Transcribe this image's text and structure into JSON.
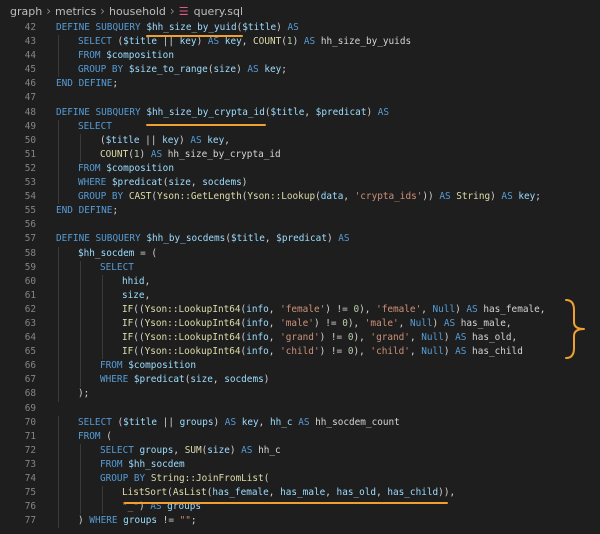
{
  "breadcrumb": {
    "items": [
      "graph",
      "metrics",
      "household"
    ],
    "file": "query.sql",
    "separator": "›",
    "file_icon": "database-icon"
  },
  "code": {
    "lines": [
      {
        "n": "42",
        "indent": 0,
        "t": [
          [
            "k",
            "DEFINE SUBQUERY "
          ],
          [
            "v",
            "$hh_size_by_yuid"
          ],
          [
            "p",
            "("
          ],
          [
            "v",
            "$title"
          ],
          [
            "p",
            ") "
          ],
          [
            "k",
            "AS"
          ]
        ]
      },
      {
        "n": "43",
        "indent": 1,
        "t": [
          [
            "k",
            "SELECT "
          ],
          [
            "p",
            "("
          ],
          [
            "v",
            "$title"
          ],
          [
            "p",
            " || "
          ],
          [
            "v",
            "key"
          ],
          [
            "p",
            ") "
          ],
          [
            "k",
            "AS "
          ],
          [
            "v",
            "key"
          ],
          [
            "p",
            ", "
          ],
          [
            "f",
            "COUNT"
          ],
          [
            "p",
            "("
          ],
          [
            "n",
            "1"
          ],
          [
            "p",
            ") "
          ],
          [
            "k",
            "AS "
          ],
          [
            "p",
            "hh_size_by_yuids"
          ]
        ]
      },
      {
        "n": "44",
        "indent": 1,
        "t": [
          [
            "k",
            "FROM "
          ],
          [
            "v",
            "$composition"
          ]
        ]
      },
      {
        "n": "45",
        "indent": 1,
        "t": [
          [
            "k",
            "GROUP BY "
          ],
          [
            "v",
            "$size_to_range"
          ],
          [
            "p",
            "("
          ],
          [
            "v",
            "size"
          ],
          [
            "p",
            ") "
          ],
          [
            "k",
            "AS "
          ],
          [
            "v",
            "key"
          ],
          [
            "p",
            ";"
          ]
        ]
      },
      {
        "n": "46",
        "indent": 0,
        "t": [
          [
            "k",
            "END DEFINE"
          ],
          [
            "p",
            ";"
          ]
        ]
      },
      {
        "n": "47",
        "indent": 0,
        "t": []
      },
      {
        "n": "48",
        "indent": 0,
        "t": [
          [
            "k",
            "DEFINE SUBQUERY "
          ],
          [
            "v",
            "$hh_size_by_crypta_id"
          ],
          [
            "p",
            "("
          ],
          [
            "v",
            "$title"
          ],
          [
            "p",
            ", "
          ],
          [
            "v",
            "$predicat"
          ],
          [
            "p",
            ") "
          ],
          [
            "k",
            "AS"
          ]
        ]
      },
      {
        "n": "49",
        "indent": 1,
        "t": [
          [
            "k",
            "SELECT"
          ]
        ]
      },
      {
        "n": "50",
        "indent": 2,
        "t": [
          [
            "p",
            "("
          ],
          [
            "v",
            "$title"
          ],
          [
            "p",
            " || "
          ],
          [
            "v",
            "key"
          ],
          [
            "p",
            ") "
          ],
          [
            "k",
            "AS "
          ],
          [
            "v",
            "key"
          ],
          [
            "p",
            ","
          ]
        ]
      },
      {
        "n": "51",
        "indent": 2,
        "t": [
          [
            "f",
            "COUNT"
          ],
          [
            "p",
            "("
          ],
          [
            "n",
            "1"
          ],
          [
            "p",
            ") "
          ],
          [
            "k",
            "AS "
          ],
          [
            "p",
            "hh_size_by_crypta_id"
          ]
        ]
      },
      {
        "n": "52",
        "indent": 1,
        "t": [
          [
            "k",
            "FROM "
          ],
          [
            "v",
            "$composition"
          ]
        ]
      },
      {
        "n": "53",
        "indent": 1,
        "t": [
          [
            "k",
            "WHERE "
          ],
          [
            "v",
            "$predicat"
          ],
          [
            "p",
            "("
          ],
          [
            "v",
            "size"
          ],
          [
            "p",
            ", "
          ],
          [
            "v",
            "socdems"
          ],
          [
            "p",
            ")"
          ]
        ]
      },
      {
        "n": "54",
        "indent": 1,
        "t": [
          [
            "k",
            "GROUP BY "
          ],
          [
            "f",
            "CAST"
          ],
          [
            "p",
            "("
          ],
          [
            "f",
            "Yson::GetLength"
          ],
          [
            "p",
            "("
          ],
          [
            "f",
            "Yson::Lookup"
          ],
          [
            "p",
            "("
          ],
          [
            "v",
            "data"
          ],
          [
            "p",
            ", "
          ],
          [
            "s",
            "'crypta_ids'"
          ],
          [
            "p",
            ")) "
          ],
          [
            "k",
            "AS "
          ],
          [
            "f",
            "String"
          ],
          [
            "p",
            ") "
          ],
          [
            "k",
            "AS "
          ],
          [
            "v",
            "key"
          ],
          [
            "p",
            ";"
          ]
        ]
      },
      {
        "n": "55",
        "indent": 0,
        "t": [
          [
            "k",
            "END DEFINE"
          ],
          [
            "p",
            ";"
          ]
        ]
      },
      {
        "n": "56",
        "indent": 0,
        "t": []
      },
      {
        "n": "57",
        "indent": 0,
        "t": [
          [
            "k",
            "DEFINE SUBQUERY "
          ],
          [
            "v",
            "$hh_by_socdems"
          ],
          [
            "p",
            "("
          ],
          [
            "v",
            "$title"
          ],
          [
            "p",
            ", "
          ],
          [
            "v",
            "$predicat"
          ],
          [
            "p",
            ") "
          ],
          [
            "k",
            "AS"
          ]
        ]
      },
      {
        "n": "58",
        "indent": 1,
        "t": [
          [
            "v",
            "$hh_socdem"
          ],
          [
            "p",
            " = ("
          ]
        ]
      },
      {
        "n": "59",
        "indent": 2,
        "t": [
          [
            "k",
            "SELECT"
          ]
        ]
      },
      {
        "n": "60",
        "indent": 3,
        "t": [
          [
            "v",
            "hhid"
          ],
          [
            "p",
            ","
          ]
        ]
      },
      {
        "n": "61",
        "indent": 3,
        "t": [
          [
            "v",
            "size"
          ],
          [
            "p",
            ","
          ]
        ]
      },
      {
        "n": "62",
        "indent": 3,
        "t": [
          [
            "f",
            "IF"
          ],
          [
            "p",
            "(("
          ],
          [
            "f",
            "Yson::LookupInt64"
          ],
          [
            "p",
            "("
          ],
          [
            "v",
            "info"
          ],
          [
            "p",
            ", "
          ],
          [
            "s",
            "'female'"
          ],
          [
            "p",
            ") != "
          ],
          [
            "n",
            "0"
          ],
          [
            "p",
            "), "
          ],
          [
            "s",
            "'female'"
          ],
          [
            "p",
            ", "
          ],
          [
            "k",
            "Null"
          ],
          [
            "p",
            ") "
          ],
          [
            "k",
            "AS "
          ],
          [
            "p",
            "has_female,"
          ]
        ]
      },
      {
        "n": "63",
        "indent": 3,
        "t": [
          [
            "f",
            "IF"
          ],
          [
            "p",
            "(("
          ],
          [
            "f",
            "Yson::LookupInt64"
          ],
          [
            "p",
            "("
          ],
          [
            "v",
            "info"
          ],
          [
            "p",
            ", "
          ],
          [
            "s",
            "'male'"
          ],
          [
            "p",
            ") != "
          ],
          [
            "n",
            "0"
          ],
          [
            "p",
            "), "
          ],
          [
            "s",
            "'male'"
          ],
          [
            "p",
            ", "
          ],
          [
            "k",
            "Null"
          ],
          [
            "p",
            ") "
          ],
          [
            "k",
            "AS "
          ],
          [
            "p",
            "has_male,"
          ]
        ]
      },
      {
        "n": "64",
        "indent": 3,
        "t": [
          [
            "f",
            "IF"
          ],
          [
            "p",
            "(("
          ],
          [
            "f",
            "Yson::LookupInt64"
          ],
          [
            "p",
            "("
          ],
          [
            "v",
            "info"
          ],
          [
            "p",
            ", "
          ],
          [
            "s",
            "'grand'"
          ],
          [
            "p",
            ") != "
          ],
          [
            "n",
            "0"
          ],
          [
            "p",
            "), "
          ],
          [
            "s",
            "'grand'"
          ],
          [
            "p",
            ", "
          ],
          [
            "k",
            "Null"
          ],
          [
            "p",
            ") "
          ],
          [
            "k",
            "AS "
          ],
          [
            "p",
            "has_old,"
          ]
        ]
      },
      {
        "n": "65",
        "indent": 3,
        "t": [
          [
            "f",
            "IF"
          ],
          [
            "p",
            "(("
          ],
          [
            "f",
            "Yson::LookupInt64"
          ],
          [
            "p",
            "("
          ],
          [
            "v",
            "info"
          ],
          [
            "p",
            ", "
          ],
          [
            "s",
            "'child'"
          ],
          [
            "p",
            ") != "
          ],
          [
            "n",
            "0"
          ],
          [
            "p",
            "), "
          ],
          [
            "s",
            "'child'"
          ],
          [
            "p",
            ", "
          ],
          [
            "k",
            "Null"
          ],
          [
            "p",
            ") "
          ],
          [
            "k",
            "AS "
          ],
          [
            "p",
            "has_child"
          ]
        ]
      },
      {
        "n": "66",
        "indent": 2,
        "t": [
          [
            "k",
            "FROM "
          ],
          [
            "v",
            "$composition"
          ]
        ]
      },
      {
        "n": "67",
        "indent": 2,
        "t": [
          [
            "k",
            "WHERE "
          ],
          [
            "v",
            "$predicat"
          ],
          [
            "p",
            "("
          ],
          [
            "v",
            "size"
          ],
          [
            "p",
            ", "
          ],
          [
            "v",
            "socdems"
          ],
          [
            "p",
            ")"
          ]
        ]
      },
      {
        "n": "68",
        "indent": 1,
        "t": [
          [
            "p",
            ");"
          ]
        ]
      },
      {
        "n": "69",
        "indent": 0,
        "t": []
      },
      {
        "n": "70",
        "indent": 1,
        "t": [
          [
            "k",
            "SELECT "
          ],
          [
            "p",
            "("
          ],
          [
            "v",
            "$title"
          ],
          [
            "p",
            " || "
          ],
          [
            "v",
            "groups"
          ],
          [
            "p",
            ") "
          ],
          [
            "k",
            "AS "
          ],
          [
            "v",
            "key"
          ],
          [
            "p",
            ", "
          ],
          [
            "v",
            "hh_c"
          ],
          [
            "p",
            " "
          ],
          [
            "k",
            "AS "
          ],
          [
            "p",
            "hh_socdem_count"
          ]
        ]
      },
      {
        "n": "71",
        "indent": 1,
        "t": [
          [
            "k",
            "FROM "
          ],
          [
            "p",
            "("
          ]
        ]
      },
      {
        "n": "72",
        "indent": 2,
        "t": [
          [
            "k",
            "SELECT "
          ],
          [
            "v",
            "groups"
          ],
          [
            "p",
            ", "
          ],
          [
            "f",
            "SUM"
          ],
          [
            "p",
            "("
          ],
          [
            "v",
            "size"
          ],
          [
            "p",
            ") "
          ],
          [
            "k",
            "AS "
          ],
          [
            "p",
            "hh_c"
          ]
        ]
      },
      {
        "n": "73",
        "indent": 2,
        "t": [
          [
            "k",
            "FROM "
          ],
          [
            "v",
            "$hh_socdem"
          ]
        ]
      },
      {
        "n": "74",
        "indent": 2,
        "t": [
          [
            "k",
            "GROUP BY "
          ],
          [
            "f",
            "String::JoinFromList"
          ],
          [
            "p",
            "("
          ]
        ]
      },
      {
        "n": "75",
        "indent": 3,
        "t": [
          [
            "f",
            "ListSort"
          ],
          [
            "p",
            "("
          ],
          [
            "f",
            "AsList"
          ],
          [
            "p",
            "("
          ],
          [
            "v",
            "has_female"
          ],
          [
            "p",
            ", "
          ],
          [
            "v",
            "has_male"
          ],
          [
            "p",
            ", "
          ],
          [
            "v",
            "has_old"
          ],
          [
            "p",
            ", "
          ],
          [
            "v",
            "has_child"
          ],
          [
            "p",
            ")),"
          ]
        ]
      },
      {
        "n": "76",
        "indent": 3,
        "t": [
          [
            "s",
            "\"_\""
          ],
          [
            "p",
            ") "
          ],
          [
            "k",
            "AS "
          ],
          [
            "v",
            "groups"
          ]
        ]
      },
      {
        "n": "77",
        "indent": 1,
        "t": [
          [
            "p",
            ") "
          ],
          [
            "k",
            "WHERE "
          ],
          [
            "v",
            "groups"
          ],
          [
            "p",
            " != "
          ],
          [
            "s",
            "\"\""
          ],
          [
            "p",
            ";"
          ]
        ]
      }
    ]
  },
  "colors": {
    "background": "#1e1e1e",
    "keyword": "#569cd6",
    "function": "#dcdcaa",
    "variable": "#9cdcfe",
    "string": "#ce9178",
    "number": "#b5cea8",
    "plain": "#d4d4d4",
    "line_number": "#858585",
    "annotation": "#f0a030"
  }
}
